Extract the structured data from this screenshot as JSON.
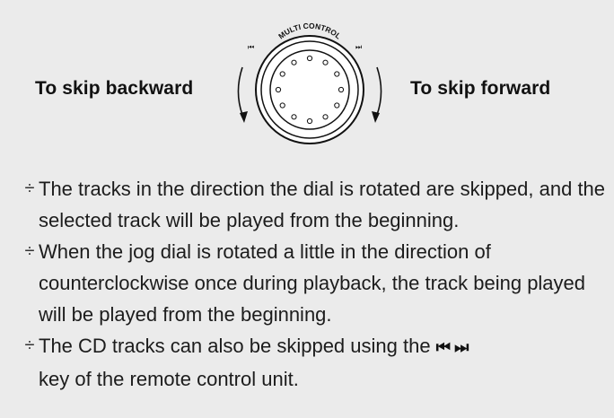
{
  "diagram": {
    "dial_name": "MULTI CONTROL",
    "skip_back_symbol": "⏮",
    "skip_forward_symbol": "⏭",
    "label_backward": "To skip backward",
    "label_forward": "To skip forward"
  },
  "notes": {
    "bullet": "÷",
    "items": [
      {
        "text": "The tracks in the direction the dial is rotated are skipped, and the selected track will be played from the beginning."
      },
      {
        "text": "When the jog dial is rotated a little in the direction of counterclockwise once during playback, the track being played will be played from the beginning."
      },
      {
        "text_before": "The CD tracks can also be skipped using the",
        "key_symbols": "⏮ ⏭",
        "text_after": "key of the remote control unit."
      }
    ]
  },
  "colors": {
    "panel_background": "#ebebeb",
    "text": "#111111",
    "line_art": "#111111"
  }
}
